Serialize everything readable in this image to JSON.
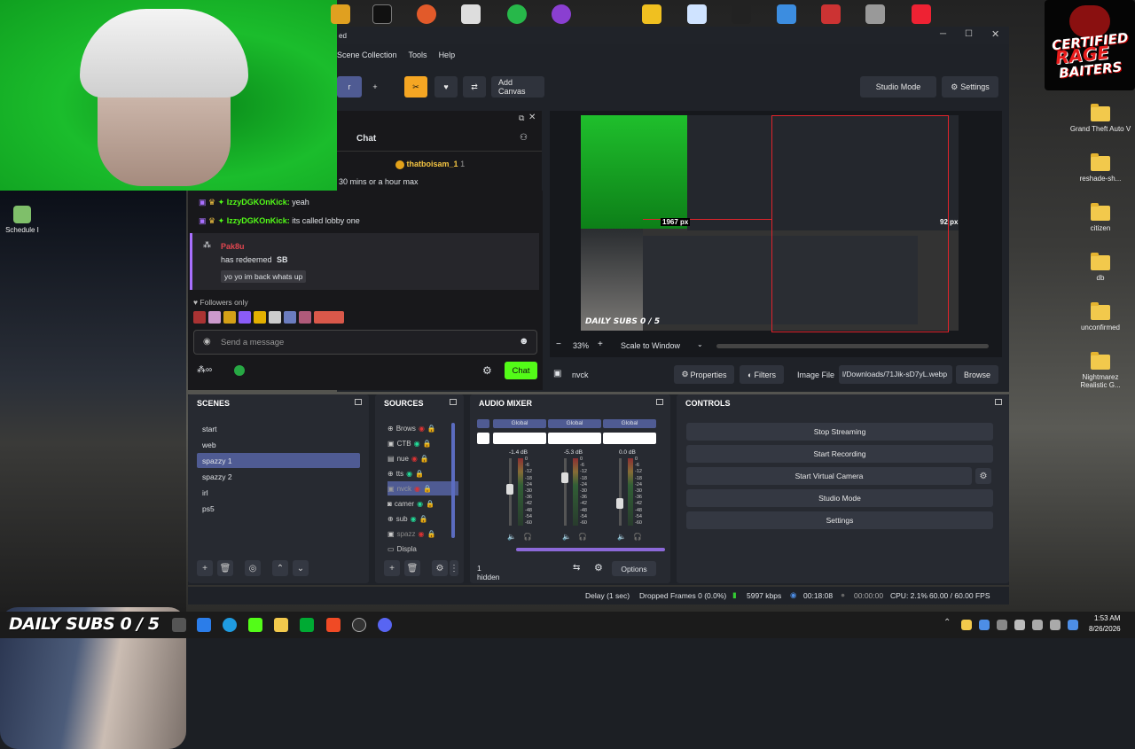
{
  "webcam": {
    "desktop_icon_label": "Schedule I"
  },
  "desktop_icons": [
    {
      "label": "Grand Theft Auto V"
    },
    {
      "label": "reshade-sh..."
    },
    {
      "label": "citizen"
    },
    {
      "label": "db"
    },
    {
      "label": "unconfirmed"
    },
    {
      "label": "Nightmarez Realistic G..."
    }
  ],
  "logo": {
    "line1": "CERTIFIED",
    "line2": "RAGE",
    "line3": "BAITERS"
  },
  "obs": {
    "title": "ed",
    "menu": [
      "Scene Collection",
      "Tools",
      "Help"
    ],
    "toolbar": {
      "add_canvas": "Add Canvas",
      "studio_mode": "Studio Mode",
      "settings": "Settings",
      "plus": "+"
    },
    "chat": {
      "title": "Chat",
      "messages": [
        {
          "user": "thatboisam_1",
          "text": "1"
        },
        {
          "user": "",
          "text": "30 mins or a hour max"
        },
        {
          "user": "IzzyDGKOnKick:",
          "text": "yeah"
        },
        {
          "user": "IzzyDGKOnKick:",
          "text": "its called lobby one"
        }
      ],
      "redeem": {
        "user": "Pak8u",
        "text": "has redeemed",
        "reward": "SB",
        "message": "yo yo im back whats up"
      },
      "followers_only": "Followers only",
      "input_placeholder": "Send a message",
      "send_button": "Chat"
    },
    "preview": {
      "zoom": "33%",
      "scale_mode": "Scale to Window",
      "px_left": "1967 px",
      "px_right": "92 px",
      "overlay_text": "DAILY SUBS 0 / 5"
    },
    "source_bar": {
      "source_name": "nvck",
      "properties": "Properties",
      "filters": "Filters",
      "image_file_label": "Image File",
      "image_path": "l/Downloads/71Jik-sD7yL.webp",
      "browse": "Browse"
    },
    "scenes": {
      "title": "SCENES",
      "items": [
        "start",
        "web",
        "spazzy 1",
        "spazzy 2",
        "irl",
        "ps5"
      ],
      "selected": "spazzy 1"
    },
    "sources": {
      "title": "SOURCES",
      "items": [
        "Brows",
        "CTB",
        "nue",
        "tts",
        "nvck",
        "camer",
        "sub",
        "spazz",
        "Displa"
      ]
    },
    "audio": {
      "title": "AUDIO MIXER",
      "channels": [
        {
          "tag": "Global",
          "db": "-1.4 dB",
          "level": 0.55
        },
        {
          "tag": "Global",
          "db": "-5.3 dB",
          "level": 0.75
        },
        {
          "tag": "Global",
          "db": "0.0 dB",
          "level": 0.3
        }
      ],
      "meter_ticks": [
        "0",
        "-6",
        "-12",
        "-18",
        "-24",
        "-30",
        "-36",
        "-42",
        "-48",
        "-54",
        "-60"
      ],
      "hidden": "1 hidden",
      "options": "Options"
    },
    "controls": {
      "title": "CONTROLS",
      "buttons": [
        "Stop Streaming",
        "Start Recording",
        "Start Virtual Camera",
        "Studio Mode",
        "Settings"
      ]
    },
    "status": {
      "delay": "Delay (1 sec)",
      "dropped": "Dropped Frames 0 (0.0%)",
      "kbps": "5997 kbps",
      "stream_time": "00:18:08",
      "rec_time": "00:00:00",
      "cpu": "CPU: 2.1%",
      "fps": "60.00 / 60.00 FPS"
    }
  },
  "taskbar": {
    "overlay": "DAILY SUBS 0 / 5",
    "time": "1:53 AM",
    "date": "8/26/2026"
  },
  "colors": {
    "accent_green": "#53fc18",
    "twitch_purple": "#a970ff",
    "obs_orange": "#f5a623",
    "select_blue": "#4f5b93",
    "record_red": "#e0232b"
  }
}
